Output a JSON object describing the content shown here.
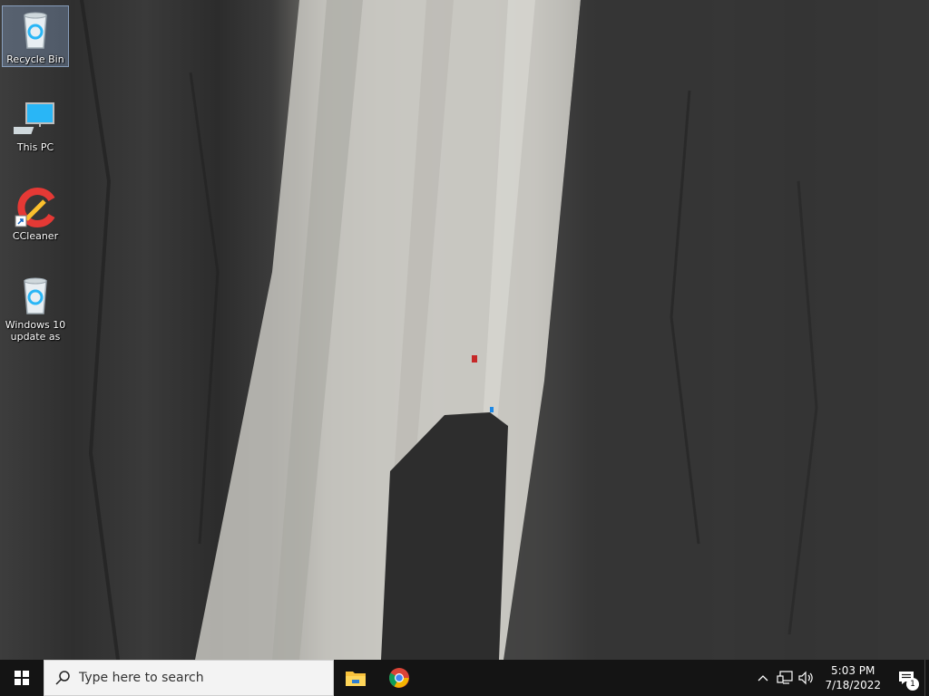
{
  "desktop": {
    "icons": [
      {
        "label": "Recycle Bin",
        "icon": "recycle-bin-icon"
      },
      {
        "label": "This PC",
        "icon": "computer-icon"
      },
      {
        "label": "CCleaner",
        "icon": "ccleaner-icon"
      },
      {
        "label": "Windows 10 update as",
        "icon": "recycle-bin-icon"
      }
    ]
  },
  "taskbar": {
    "start_icon": "windows-logo-icon",
    "search_placeholder": "Type here to search",
    "pinned_apps": [
      "file-explorer-icon",
      "chrome-icon"
    ],
    "tray": {
      "time": "5:03 PM",
      "date": "7/18/2022",
      "notification_count": "1"
    }
  },
  "colors": {
    "taskbar_bg": "#141414",
    "search_bg": "#f3f3f3",
    "accent_blue": "#1e88e5"
  }
}
